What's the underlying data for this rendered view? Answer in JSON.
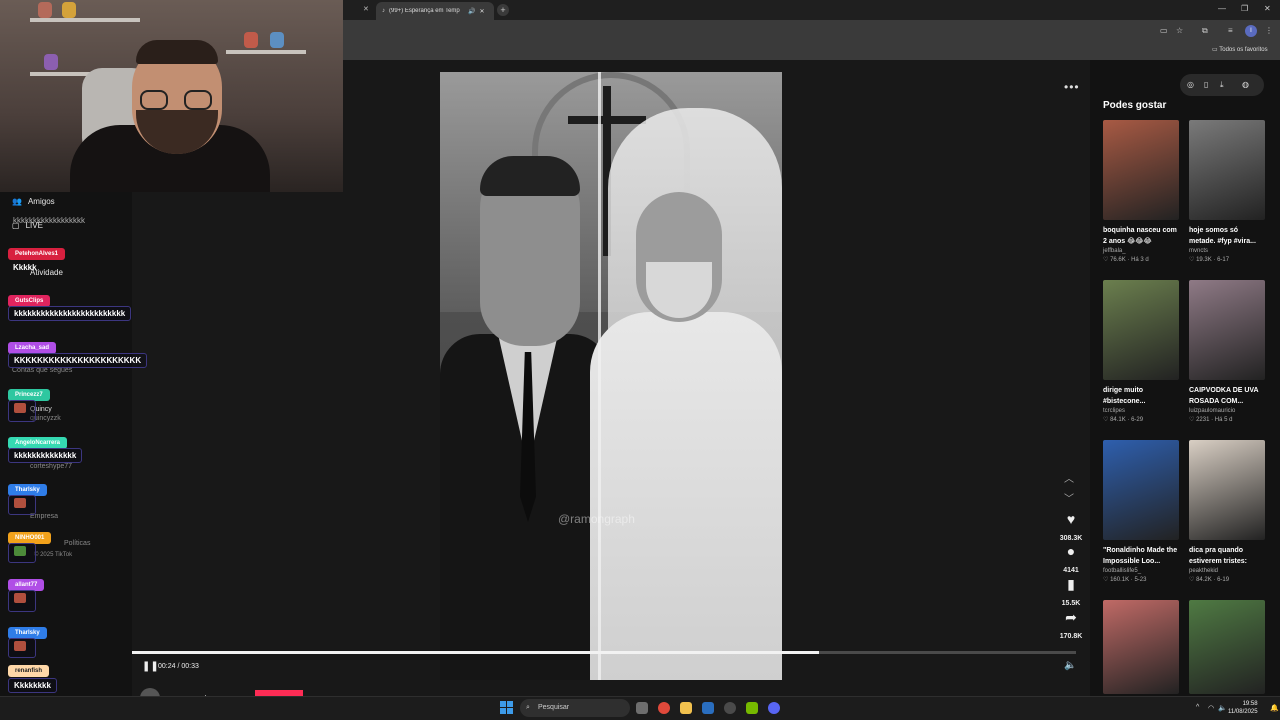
{
  "browser": {
    "tabs": [
      {
        "title": "(99+) Esperança em Temp"
      }
    ],
    "bookmarks_label": "Todos os favoritos",
    "profile_initial": "I"
  },
  "left_nav": {
    "friends": "Amigos",
    "live": "LIVE",
    "activity": "Atividade",
    "following_accounts": "Contas que segues",
    "followed": [
      {
        "name": "Quincy",
        "handle": "quincyzzk"
      },
      {
        "name": "corteshype77"
      }
    ],
    "company": "Empresa",
    "policies": "Políticas",
    "copyright": "© 2025 TikTok"
  },
  "chat": [
    {
      "user": "PetehonAlves1",
      "text": "Kkkkk",
      "color": "#d8203f"
    },
    {
      "user": "GutsClips",
      "text": "kkkkkkkkkkkkkkkkkkkkkkkkk",
      "color": "#e0245e"
    },
    {
      "user": "Lzacha_sad",
      "text": "KKKKKKKKKKKKKKKKKKKKKK",
      "color": "#b04ee6"
    },
    {
      "user": "Princezz7",
      "text": "",
      "color": "#2ec7a0"
    },
    {
      "user": "AngeloNcarrera",
      "text": "kkkkkkkkkkkkkk",
      "color": "#35d9b2"
    },
    {
      "user": "Tharlsky",
      "text": "",
      "color": "#2f7de8"
    },
    {
      "user": "NINHO001",
      "text": "",
      "color": "#f2a21b"
    },
    {
      "user": "allant77",
      "text": "",
      "color": "#b04ee6"
    },
    {
      "user": "Tharlsky",
      "text": "",
      "color": "#2f7de8"
    },
    {
      "user": "renanfish",
      "text": "Kkkkkkkk",
      "color": "#ffd8a8"
    }
  ],
  "chat_top_fragment": "kkkkkkkkkkkkkkkkkk",
  "video": {
    "watermark": "@ramongraph",
    "current_time": "00:24",
    "duration": "00:33",
    "progress_fraction": 0.7273,
    "author": "ramongraph",
    "stats": {
      "likes": "308.3K",
      "comments": "4141",
      "saves": "15.5K",
      "shares": "170.8K"
    }
  },
  "suggestions": {
    "title": "Podes gostar",
    "items": [
      {
        "caption": "boquinha nasceu com 2 anos 😂😂😂",
        "user": "jeffbala_",
        "likes": "76.6K",
        "age": "Há 3 d",
        "color": "#a85a44"
      },
      {
        "caption": "hoje somos só metade. #fyp #vira...",
        "user": "mvncts",
        "likes": "19.3K",
        "age": "6-17",
        "color": "#7a7a7a"
      },
      {
        "caption": "dirige muito #bistecone...",
        "user": "tcrclipes",
        "likes": "84.1K",
        "age": "6-29",
        "color": "#6b7f4e"
      },
      {
        "caption": "CAIPVODKA DE UVA ROSADA COM...",
        "user": "luizpaulomauricio",
        "likes": "2231",
        "age": "Há 5 d",
        "color": "#8f7a86"
      },
      {
        "caption": "\"Ronaldinho Made the Impossible Loo...",
        "user": "footballislife5_",
        "likes": "160.1K",
        "age": "5-23",
        "color": "#2e5fae"
      },
      {
        "caption": "dica pra quando estiverem tristes:",
        "user": "peakthekid",
        "likes": "84.2K",
        "age": "6-19",
        "color": "#d9cfc4"
      },
      {
        "caption": "",
        "user": "",
        "likes": "",
        "age": "",
        "color": "#c06a66"
      },
      {
        "caption": "",
        "user": "",
        "likes": "",
        "age": "",
        "color": "#4f7a43"
      }
    ]
  },
  "taskbar": {
    "search_placeholder": "Pesquisar",
    "time": "19:58",
    "date": "11/08/2025"
  }
}
